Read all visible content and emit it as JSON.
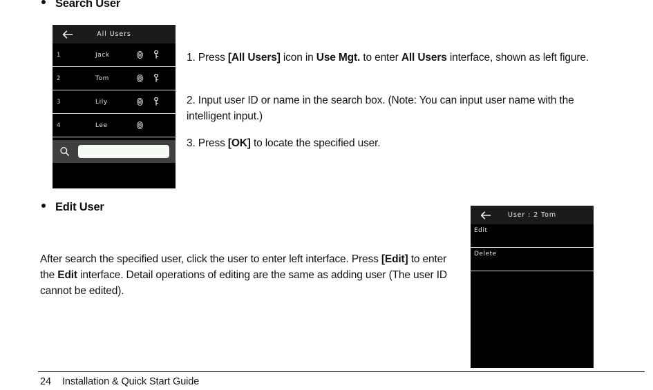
{
  "headings": {
    "search_user": "Search User",
    "edit_user": "Edit User"
  },
  "all_users_device": {
    "back_icon": "back-arrow-icon",
    "title": "All Users",
    "icon_names": {
      "fingerprint": "fingerprint-icon",
      "key": "key-icon",
      "search": "search-icon"
    },
    "rows": [
      {
        "index": "1",
        "name": "Jack",
        "fingerprint": true,
        "key": true
      },
      {
        "index": "2",
        "name": "Tom",
        "fingerprint": true,
        "key": true
      },
      {
        "index": "3",
        "name": "Lily",
        "fingerprint": true,
        "key": true
      },
      {
        "index": "4",
        "name": "Lee",
        "fingerprint": true,
        "key": false
      }
    ],
    "search": {
      "value": "",
      "placeholder": ""
    }
  },
  "user_detail_device": {
    "back_icon": "back-arrow-icon",
    "title": "User : 2 Tom",
    "menu": [
      {
        "label": "Edit"
      },
      {
        "label": "Delete"
      }
    ]
  },
  "instructions": {
    "step1": {
      "num": "1. ",
      "t1": "Press ",
      "b1": "[All Users]",
      "t2": " icon in ",
      "b2": "Use Mgt.",
      "t3": " to enter ",
      "b3": "All Users",
      "t4": " interface, shown as left figure."
    },
    "step2": {
      "num": "2. ",
      "t1": "Input user ID or name in the search box. (Note: You can input user name with the intelligent input.)"
    },
    "step3": {
      "num": "3. ",
      "t1": "Press ",
      "b1": "[OK]",
      "t2": " to locate the specified user."
    }
  },
  "edit_paragraph": {
    "t1": "After search the specified user, click the user to enter left interface. Press ",
    "b1": "[Edit]",
    "t2": " to enter the ",
    "b2": "Edit",
    "t3": " interface. Detail operations of editing are the same as adding user (The user ID cannot be edited)."
  },
  "footer": {
    "page_number": "24",
    "title": "Installation & Quick Start Guide"
  },
  "colors": {
    "device_background": "#000000",
    "device_header": "#1b1b1b",
    "search_bar": "#3f3f3f",
    "search_field": "#f5faf4",
    "row_divider": "#d8d8d8",
    "device_text": "#e6e6e6",
    "page_text": "#131313"
  }
}
